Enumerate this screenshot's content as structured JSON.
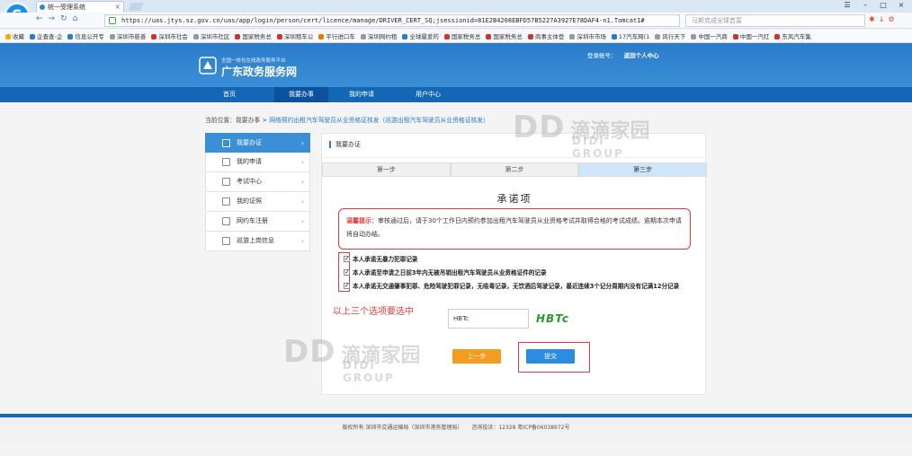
{
  "browser": {
    "tab_title": "统一受理系统",
    "url": "https://uas.jtys.sz.gov.cn/uas/app/login/person/cert/licence/manage/DRIVER_CERT_SQ;jsessionid=81E2B4208EBFD57B5227A3927E78DAF4-n1.Tomcat1#",
    "search_placeholder": "马斯克成全球首富",
    "bookmarks": [
      "收藏",
      "企查查-企",
      "信息公开专",
      "深圳市慈善",
      "深圳市社会",
      "深圳市社区",
      "国家税务总",
      "深圳租车公",
      "平行进口车",
      "深圳网约租",
      "全球最爱的",
      "国家税务总",
      "国家税务总",
      "商事主体登",
      "深圳市市场",
      "17汽车网(1",
      "风行天下",
      "中国一汽商",
      "中国一汽红",
      "东风汽车集"
    ]
  },
  "site": {
    "subtitle": "全国一体化在线政务服务平台",
    "title": "广东政务服务网",
    "account_label": "登录帐号：",
    "personal_center": "返回个人中心"
  },
  "mainnav": [
    "首页",
    "我要办事",
    "我的申请",
    "用户中心"
  ],
  "breadcrumb": {
    "prefix": "当前位置：我要办事 >",
    "link": "网络预约出租汽车驾驶员从业资格证核发（巡游出租汽车驾驶员从业资格证核发）"
  },
  "sidebar": [
    "我要办证",
    "我的申请",
    "考试中心",
    "我的证照",
    "网约车注册",
    "巡游上岗信息"
  ],
  "panel": {
    "title": "我要办证",
    "steps": [
      "第一步",
      "第二步",
      "第三步"
    ],
    "pledge_title": "承诺项",
    "tip_label": "温馨提示：",
    "tip_text": "审核通过后，请于30个工作日内预约参加出租汽车驾驶员从业资格考试并取得合格的考试成绩。逾期本次申请将自动办结。",
    "checks": [
      "本人承诺无暴力犯罪记录",
      "本人承诺至申请之日前3年内无被吊销出租汽车驾驶员从业资格证件的记录",
      "本人承诺无交通肇事犯罪、危险驾驶犯罪记录，无吸毒记录，无饮酒后驾驶记录，最近连续3个记分周期内没有记满12分记录"
    ],
    "annotation": "以上三个选项要选中",
    "captcha_value": "HBTc",
    "captcha_image_text": "HBTc",
    "prev_button": "上一步",
    "submit_button": "提交"
  },
  "watermark": {
    "mark": "DD",
    "cn": "滴滴家园",
    "en": "DIDI GROUP"
  },
  "footer": [
    "版权所有 深圳市交通运输局（深圳市港务管理局）",
    "咨询投诉：12328 粤ICP备06038972号"
  ]
}
